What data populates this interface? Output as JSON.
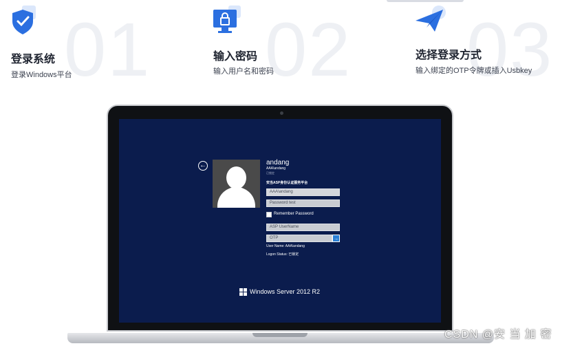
{
  "steps": [
    {
      "number": "01",
      "title": "登录系统",
      "desc": "登录Windows平台",
      "icon": "shield-check-icon"
    },
    {
      "number": "02",
      "title": "输入密码",
      "desc": "输入用户名和密码",
      "icon": "monitor-lock-icon"
    },
    {
      "number": "03",
      "title": "选择登录方式",
      "desc": "输入绑定的OTP令牌或插入Usbkey",
      "icon": "paper-plane-icon"
    }
  ],
  "login": {
    "username": "andang",
    "domain_user": "AAA\\andang",
    "status_small": "已锁定",
    "platform": "安当ASP身份认证服务平台",
    "user_field": "AAA\\andang",
    "password_placeholder": "Password test",
    "remember_label": "Remember Password",
    "asp_placeholder": "ASP UserName",
    "otp_placeholder": "OTP",
    "go_arrow": "→",
    "back_arrow": "←",
    "user_name_line": "User Name: AAA\\andang",
    "logon_status_line": "Logon Status: 已锁定",
    "os_label": "Windows Server 2012 R2"
  },
  "watermark": "CSDN @安 当 加 密",
  "colors": {
    "accent": "#2a7fd6",
    "screen": "#0b1c4d",
    "brand_blue": "#2b6fe0"
  }
}
